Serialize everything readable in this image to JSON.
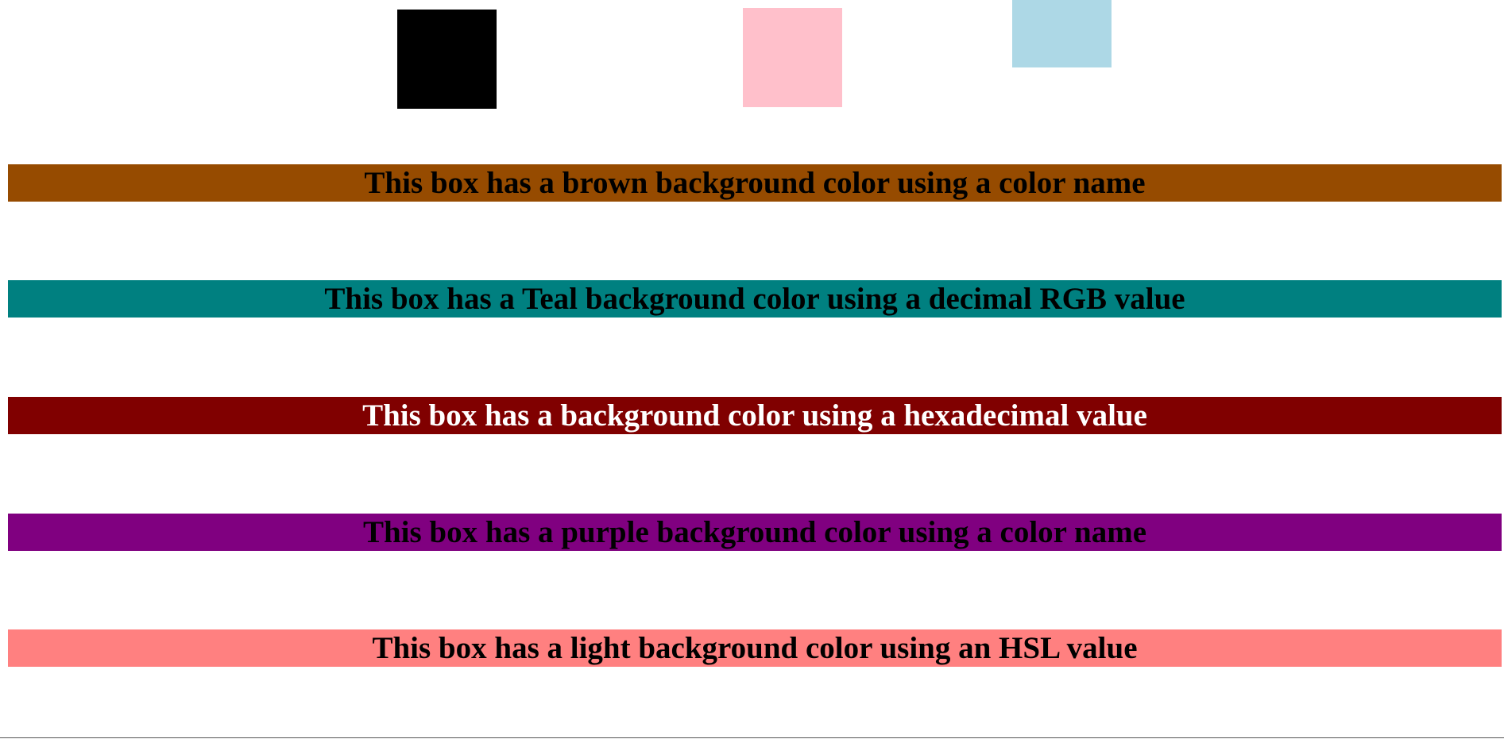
{
  "swatches": [
    {
      "name": "black",
      "color": "#000000"
    },
    {
      "name": "pink",
      "color": "#ffc0cb"
    },
    {
      "name": "lightblue",
      "color": "#add8e6"
    }
  ],
  "banners": [
    {
      "text": "This box has a brown background color using a color name",
      "background": "#964B00",
      "text_color": "#000000"
    },
    {
      "text": "This box has a Teal background color using a decimal RGB value",
      "background": "#008080",
      "text_color": "#000000"
    },
    {
      "text": "This box has a background color using a hexadecimal value",
      "background": "#800000",
      "text_color": "#ffffff"
    },
    {
      "text": "This box has a purple background color using a color name",
      "background": "#800080",
      "text_color": "#000000"
    },
    {
      "text": "This box has a light background color using an HSL value",
      "background": "#ff8080",
      "text_color": "#000000"
    }
  ]
}
